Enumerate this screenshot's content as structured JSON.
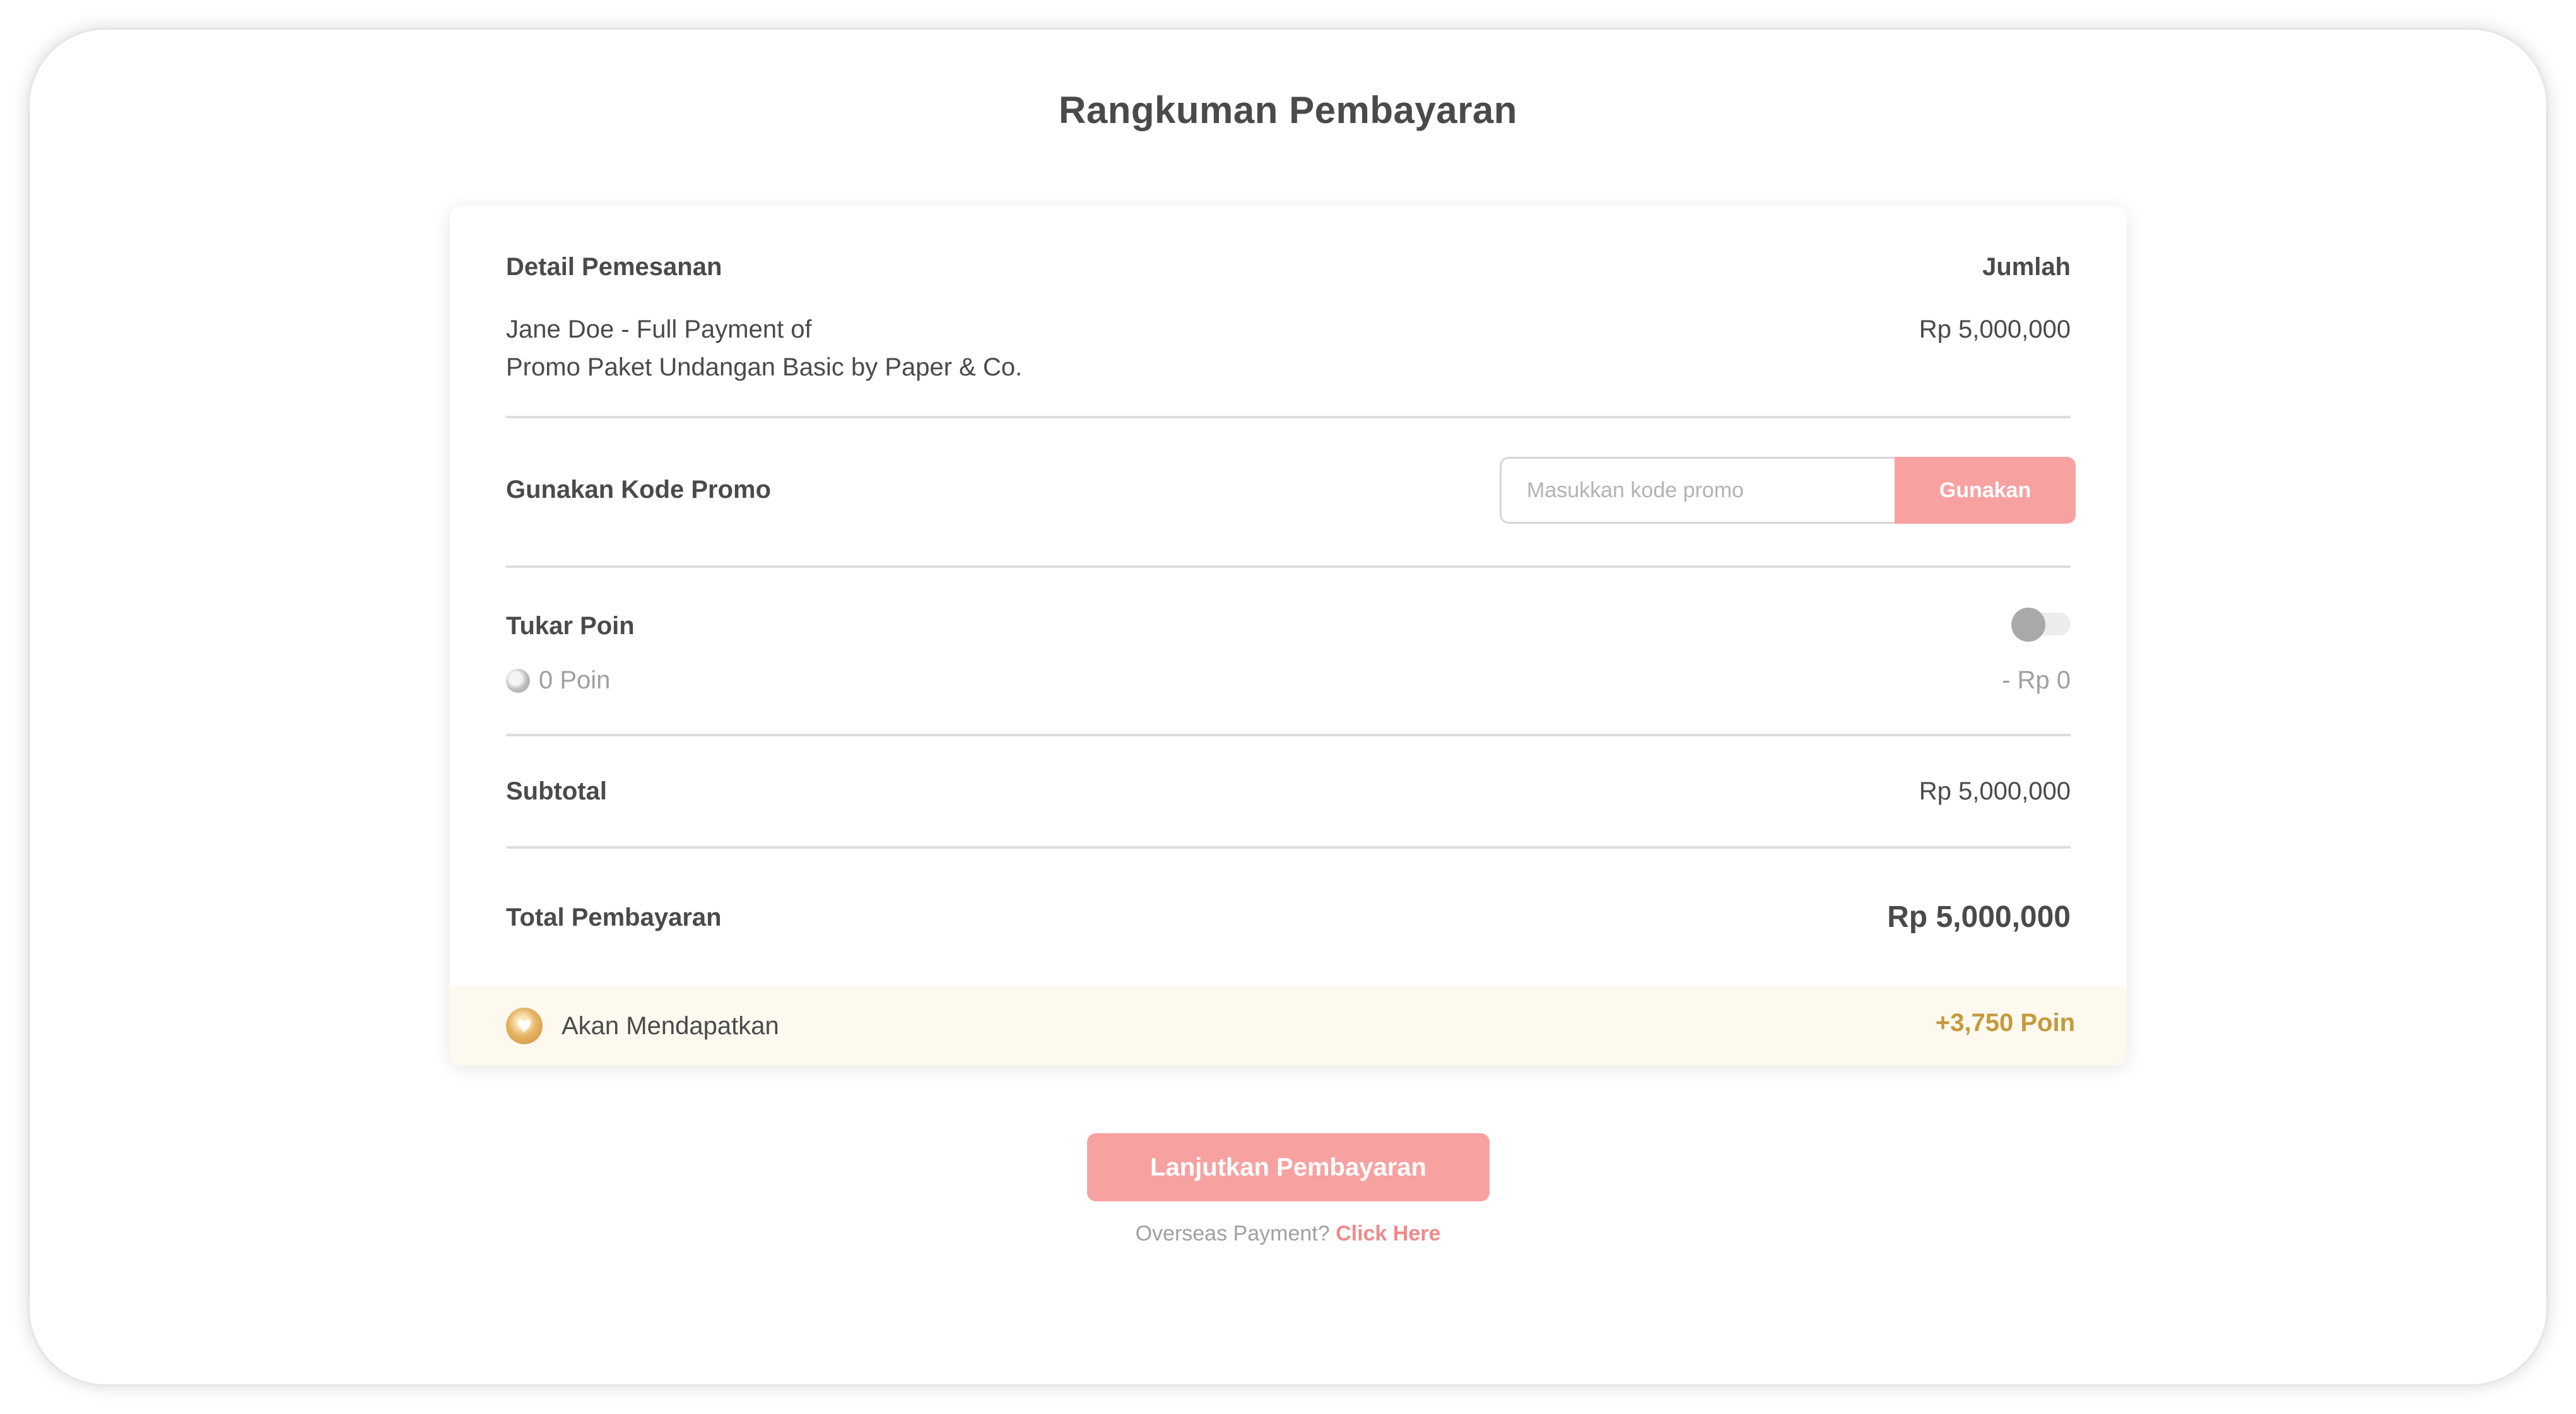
{
  "page": {
    "title": "Rangkuman Pembayaran"
  },
  "order": {
    "header_left": "Detail Pemesanan",
    "header_right": "Jumlah",
    "line1": "Jane Doe - Full Payment of",
    "line2": "Promo Paket Undangan Basic by Paper & Co.",
    "amount": "Rp 5,000,000"
  },
  "promo": {
    "label": "Gunakan Kode Promo",
    "placeholder": "Masukkan kode promo",
    "value": "",
    "button_label": "Gunakan"
  },
  "points": {
    "title": "Tukar Poin",
    "balance": "0 Poin",
    "discount": "- Rp 0",
    "toggle_on": false,
    "coin_icon": "silver-coin-icon"
  },
  "subtotal": {
    "label": "Subtotal",
    "value": "Rp 5,000,000"
  },
  "total": {
    "label": "Total Pembayaran",
    "value": "Rp 5,000,000"
  },
  "earn": {
    "label": "Akan Mendapatkan",
    "value": "+3,750 Poin",
    "coin_icon": "gold-heart-coin-icon"
  },
  "cta": {
    "label": "Lanjutkan Pembayaran"
  },
  "overseas": {
    "text": "Overseas Payment? ",
    "link": "Click Here"
  },
  "colors": {
    "accent_pink": "#f7a1a1",
    "link_pink": "#f08a8a",
    "gold": "#c49a3c",
    "earn_bg": "#fdf9ef",
    "text": "#4a4a4a",
    "muted": "#a0a0a0"
  }
}
